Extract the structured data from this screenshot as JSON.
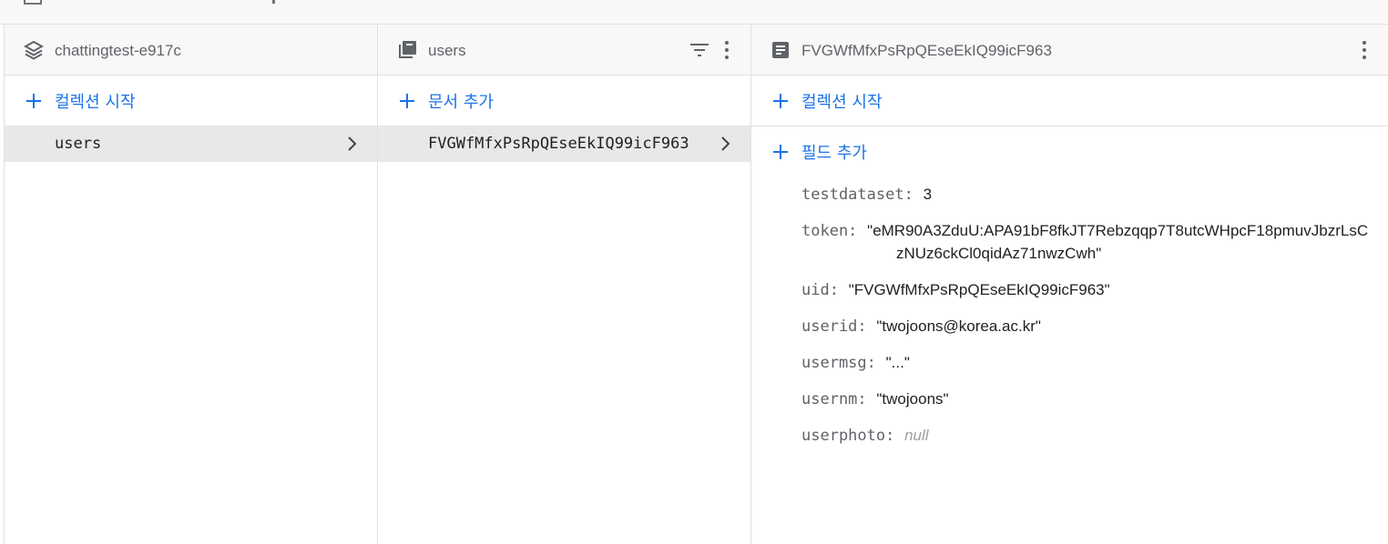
{
  "columns": {
    "root": {
      "title": "chattingtest-e917c",
      "add_label": "컬렉션 시작",
      "items": [
        {
          "label": "users",
          "selected": true
        }
      ]
    },
    "collection": {
      "title": "users",
      "add_label": "문서 추가",
      "items": [
        {
          "label": "FVGWfMfxPsRpQEseEkIQ99icF963",
          "selected": true
        }
      ]
    },
    "document": {
      "title": "FVGWfMfxPsRpQEseEkIQ99icF963",
      "add_collection_label": "컬렉션 시작",
      "add_field_label": "필드 추가",
      "fields": [
        {
          "key": "testdataset:",
          "value": "3"
        },
        {
          "key": "token:",
          "value": "\"eMR90A3ZduU:APA91bF8fkJT7Rebzqqp7T8utcWHpcF18pmuvJbzrLsC",
          "value_line2": "zNUz6ckCl0qidAz71nwzCwh\""
        },
        {
          "key": "uid:",
          "value": "\"FVGWfMfxPsRpQEseEkIQ99icF963\""
        },
        {
          "key": "userid:",
          "value": "\"twojoons@korea.ac.kr\""
        },
        {
          "key": "usermsg:",
          "value": "\"...\""
        },
        {
          "key": "usernm:",
          "value": "\"twojoons\""
        },
        {
          "key": "userphoto:",
          "value": "null"
        }
      ]
    }
  },
  "colors": {
    "accent": "#1a73e8",
    "icon": "#5f6368",
    "selected_bg": "#e8e8e8"
  }
}
